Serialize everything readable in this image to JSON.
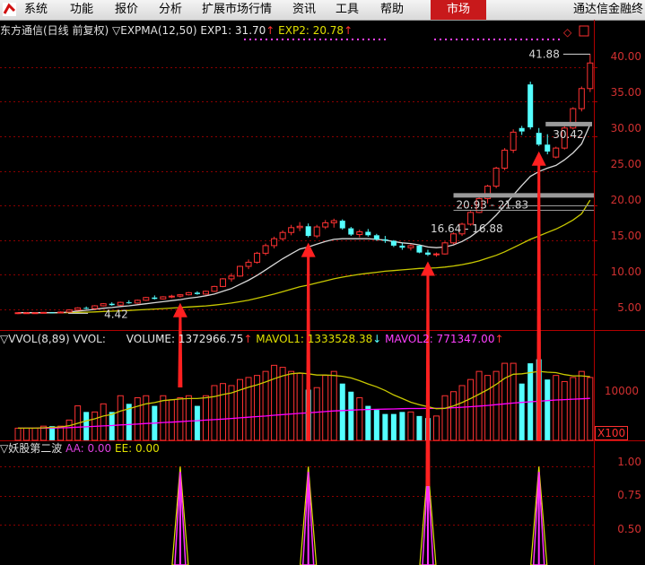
{
  "menu": {
    "items": [
      "系统",
      "功能",
      "报价",
      "分析",
      "扩展市场行情",
      "资讯",
      "工具",
      "帮助"
    ],
    "active": "市场",
    "brand": "通达信金融终"
  },
  "price_panel": {
    "stock": "东方通信(日线 前复权)",
    "indicator": "▽EXPMA(12,50)",
    "exp1_label": "EXP1: 31.70",
    "exp2_label": "EXP2: 20.78",
    "up_arrow": "↑",
    "y_ticks": [
      "40.00",
      "35.00",
      "30.00",
      "25.00",
      "20.00",
      "15.00",
      "10.00",
      "5.00"
    ],
    "annotations": [
      "41.88",
      "30.42",
      "20.93 - 21.83",
      "16.64 - 16.88",
      "4.42"
    ]
  },
  "volume_panel": {
    "indicator": "▽VVOL(8,89)",
    "vol_label": "VVOL:",
    "volume_label": "VOLUME: 1372966.75",
    "mavol1_label": "MAVOL1: 1333528.38",
    "mavol2_label": "MAVOL2: 771347.00",
    "down_arrow": "↓",
    "y_tick": "10000",
    "unit": "X100"
  },
  "signal_panel": {
    "indicator": "▽妖股第二波",
    "aa_label": "AA: 0.00",
    "ee_label": "EE: 0.00",
    "y_ticks": [
      "1.00",
      "0.75",
      "0.50"
    ]
  },
  "colors": {
    "up": "#ff3232",
    "down": "#54ffff",
    "exp1": "#d8d8d8",
    "exp2": "#c8c800",
    "mavol2": "#ff00ff",
    "grid": "#8b0000",
    "signal_arrow": "#ff2020"
  },
  "chart_data": {
    "type": "candlestick",
    "y_range": [
      2,
      44
    ],
    "y_ticks": [
      40,
      35,
      30,
      25,
      20,
      15,
      10,
      5
    ],
    "candles": [
      [
        4.5,
        4.6,
        4.3,
        4.5
      ],
      [
        4.5,
        4.6,
        4.4,
        4.5
      ],
      [
        4.5,
        4.6,
        4.4,
        4.5
      ],
      [
        4.5,
        4.6,
        4.4,
        4.55
      ],
      [
        4.55,
        4.6,
        4.42,
        4.5
      ],
      [
        4.5,
        4.7,
        4.45,
        4.6
      ],
      [
        4.6,
        5.0,
        4.55,
        4.9
      ],
      [
        4.9,
        5.3,
        4.8,
        5.2
      ],
      [
        5.2,
        5.4,
        5.0,
        5.1
      ],
      [
        5.1,
        5.6,
        5.0,
        5.5
      ],
      [
        5.5,
        5.9,
        5.4,
        5.8
      ],
      [
        5.8,
        6.0,
        5.5,
        5.6
      ],
      [
        5.6,
        6.1,
        5.5,
        6.0
      ],
      [
        6.0,
        6.3,
        5.8,
        5.9
      ],
      [
        5.9,
        6.4,
        5.8,
        6.3
      ],
      [
        6.3,
        6.8,
        6.2,
        6.7
      ],
      [
        6.7,
        7.0,
        6.4,
        6.5
      ],
      [
        6.5,
        6.9,
        6.4,
        6.8
      ],
      [
        6.8,
        7.1,
        6.6,
        6.9
      ],
      [
        6.9,
        7.2,
        6.7,
        7.1
      ],
      [
        7.1,
        7.5,
        7.0,
        7.4
      ],
      [
        7.4,
        7.6,
        7.1,
        7.2
      ],
      [
        7.2,
        7.7,
        7.1,
        7.6
      ],
      [
        7.6,
        8.4,
        7.5,
        8.3
      ],
      [
        8.3,
        9.5,
        8.2,
        9.4
      ],
      [
        9.4,
        10.2,
        9.0,
        9.8
      ],
      [
        9.8,
        11.3,
        9.7,
        11.2
      ],
      [
        11.2,
        12.2,
        10.8,
        11.8
      ],
      [
        11.8,
        13.3,
        11.6,
        13.1
      ],
      [
        13.1,
        14.5,
        12.8,
        14.2
      ],
      [
        14.2,
        15.5,
        13.8,
        15.2
      ],
      [
        15.2,
        16.4,
        14.9,
        16.1
      ],
      [
        16.1,
        17.2,
        15.7,
        16.8
      ],
      [
        16.8,
        17.6,
        16.3,
        17.0
      ],
      [
        17.0,
        17.4,
        15.4,
        15.6
      ],
      [
        15.6,
        17.2,
        15.3,
        16.9
      ],
      [
        16.9,
        17.9,
        16.6,
        17.5
      ],
      [
        17.5,
        18.1,
        16.8,
        17.8
      ],
      [
        17.8,
        18.0,
        16.5,
        16.7
      ],
      [
        16.7,
        16.9,
        15.6,
        15.8
      ],
      [
        15.8,
        16.5,
        15.4,
        16.2
      ],
      [
        16.2,
        16.6,
        15.5,
        15.7
      ],
      [
        15.7,
        15.9,
        14.9,
        15.1
      ],
      [
        15.1,
        15.6,
        14.6,
        14.9
      ],
      [
        14.9,
        15.0,
        14.0,
        14.2
      ],
      [
        14.2,
        14.6,
        13.6,
        13.9
      ],
      [
        13.9,
        14.4,
        13.5,
        14.2
      ],
      [
        14.2,
        14.3,
        13.1,
        13.2
      ],
      [
        13.2,
        13.6,
        12.7,
        12.9
      ],
      [
        12.9,
        13.2,
        12.6,
        13.0
      ],
      [
        13.0,
        14.8,
        12.9,
        14.6
      ],
      [
        14.6,
        16.1,
        14.4,
        15.9
      ],
      [
        15.9,
        17.5,
        15.6,
        17.3
      ],
      [
        17.3,
        19.2,
        17.1,
        19.0
      ],
      [
        19.0,
        21.3,
        18.9,
        21.0
      ],
      [
        21.0,
        23.0,
        20.3,
        22.8
      ],
      [
        22.8,
        25.6,
        22.5,
        25.4
      ],
      [
        25.4,
        28.3,
        25.1,
        28.0
      ],
      [
        28.0,
        31.0,
        27.6,
        30.6
      ],
      [
        31.2,
        31.5,
        30.2,
        30.7
      ],
      [
        37.5,
        37.9,
        31.0,
        31.3
      ],
      [
        30.5,
        31.2,
        28.6,
        28.8
      ],
      [
        28.8,
        30.3,
        27.4,
        27.8
      ],
      [
        27.0,
        28.5,
        26.8,
        28.3
      ],
      [
        28.3,
        31.5,
        28.1,
        31.2
      ],
      [
        31.2,
        34.2,
        31.0,
        34.0
      ],
      [
        34.0,
        37.2,
        33.6,
        36.9
      ],
      [
        36.9,
        41.88,
        36.4,
        40.6
      ]
    ],
    "exp1": [
      4.5,
      4.5,
      4.5,
      4.5,
      4.5,
      4.52,
      4.6,
      4.75,
      4.85,
      5.0,
      5.15,
      5.25,
      5.4,
      5.5,
      5.65,
      5.8,
      5.95,
      6.1,
      6.25,
      6.4,
      6.6,
      6.75,
      6.95,
      7.2,
      7.6,
      8.0,
      8.6,
      9.2,
      9.9,
      10.7,
      11.5,
      12.3,
      13.0,
      13.7,
      14.0,
      14.4,
      14.8,
      15.1,
      15.2,
      15.2,
      15.2,
      15.2,
      15.1,
      15.0,
      14.8,
      14.6,
      14.5,
      14.3,
      14.0,
      13.9,
      14.0,
      14.3,
      14.8,
      15.5,
      16.4,
      17.4,
      18.6,
      20.0,
      21.5,
      22.9,
      24.2,
      24.9,
      25.4,
      25.8,
      26.6,
      27.6,
      28.9,
      31.7
    ],
    "exp2": [
      4.5,
      4.5,
      4.5,
      4.5,
      4.5,
      4.5,
      4.52,
      4.55,
      4.58,
      4.62,
      4.68,
      4.72,
      4.78,
      4.83,
      4.9,
      4.97,
      5.03,
      5.1,
      5.17,
      5.25,
      5.33,
      5.41,
      5.49,
      5.6,
      5.75,
      5.9,
      6.1,
      6.3,
      6.6,
      6.9,
      7.2,
      7.55,
      7.9,
      8.25,
      8.5,
      8.8,
      9.1,
      9.4,
      9.65,
      9.85,
      10.05,
      10.2,
      10.35,
      10.5,
      10.6,
      10.7,
      10.8,
      10.9,
      10.95,
      11.0,
      11.1,
      11.25,
      11.45,
      11.7,
      12.0,
      12.4,
      12.8,
      13.3,
      13.9,
      14.5,
      15.1,
      15.6,
      16.1,
      16.6,
      17.2,
      17.9,
      18.8,
      20.78
    ],
    "volume": {
      "y_tick": 10000,
      "values": [
        3,
        3,
        3,
        3.5,
        3.5,
        3.5,
        5,
        8.5,
        7,
        7,
        9,
        7,
        11,
        9,
        10.5,
        11,
        8.5,
        11,
        10,
        10.5,
        11,
        8.5,
        11,
        13.5,
        14,
        13.5,
        15,
        15.5,
        16,
        17,
        18.5,
        18,
        17,
        16.5,
        12.5,
        13,
        16,
        17,
        14,
        12,
        10.5,
        8.5,
        7.5,
        6.5,
        6.5,
        7,
        7,
        6,
        5.5,
        6,
        11,
        12,
        13.5,
        15,
        17,
        16,
        17,
        19,
        19,
        14,
        19,
        20,
        15,
        16,
        14.5,
        15.5,
        17,
        15.5
      ],
      "mavol1": [
        3,
        3,
        3,
        3.1,
        3.2,
        3.3,
        3.6,
        4.2,
        4.8,
        5.3,
        6.0,
        6.4,
        7.2,
        7.8,
        8.4,
        9.0,
        9.3,
        9.8,
        10.0,
        10.2,
        10.3,
        10.3,
        10.5,
        10.8,
        11.3,
        11.7,
        12.4,
        13.1,
        13.7,
        14.4,
        15.2,
        15.9,
        16.4,
        16.6,
        16.4,
        16.1,
        16.1,
        16.0,
        15.8,
        15.4,
        14.7,
        13.9,
        13.2,
        12.3,
        11.2,
        10.3,
        9.4,
        8.8,
        8.3,
        7.8,
        7.9,
        8.5,
        9.3,
        10.3,
        11.4,
        12.5,
        13.8,
        15.3,
        16.3,
        16.4,
        16.7,
        17.0,
        16.8,
        16.7,
        16.2,
        15.9,
        15.9,
        15.7
      ],
      "mavol2": [
        3,
        3,
        3,
        3,
        3.05,
        3.1,
        3.15,
        3.25,
        3.35,
        3.45,
        3.55,
        3.65,
        3.8,
        3.9,
        4.0,
        4.15,
        4.25,
        4.4,
        4.5,
        4.6,
        4.75,
        4.85,
        5.0,
        5.1,
        5.25,
        5.4,
        5.55,
        5.7,
        5.85,
        6.0,
        6.2,
        6.35,
        6.5,
        6.65,
        6.8,
        6.95,
        7.1,
        7.25,
        7.35,
        7.45,
        7.55,
        7.6,
        7.65,
        7.7,
        7.75,
        7.8,
        7.85,
        7.85,
        7.9,
        7.9,
        7.95,
        8.05,
        8.15,
        8.3,
        8.45,
        8.6,
        8.8,
        9.0,
        9.2,
        9.35,
        9.5,
        9.65,
        9.8,
        9.95,
        10.05,
        10.15,
        10.25,
        10.35
      ],
      "max": 23
    },
    "signal": {
      "y_ticks": [
        1.0,
        0.75,
        0.5
      ],
      "y_range": [
        0.15,
        1.08
      ],
      "spikes": [
        {
          "index": 19,
          "value": 1.0
        },
        {
          "index": 34,
          "value": 1.0
        },
        {
          "index": 48,
          "value": 1.0
        },
        {
          "index": 61,
          "value": 1.0
        }
      ]
    },
    "markers": [
      {
        "label": "41.88",
        "index": 67,
        "price": 41.88
      },
      {
        "label": "30.42",
        "index": 62,
        "price": 30.42
      },
      {
        "label": "20.93 - 21.83",
        "from": 51,
        "price": 21.4
      },
      {
        "label": "16.64 - 16.88",
        "from": 48,
        "price": 16.76
      },
      {
        "label": "4.42",
        "index": 4,
        "price": 4.42
      }
    ],
    "signal_arrows": [
      19,
      34,
      48,
      61
    ]
  }
}
